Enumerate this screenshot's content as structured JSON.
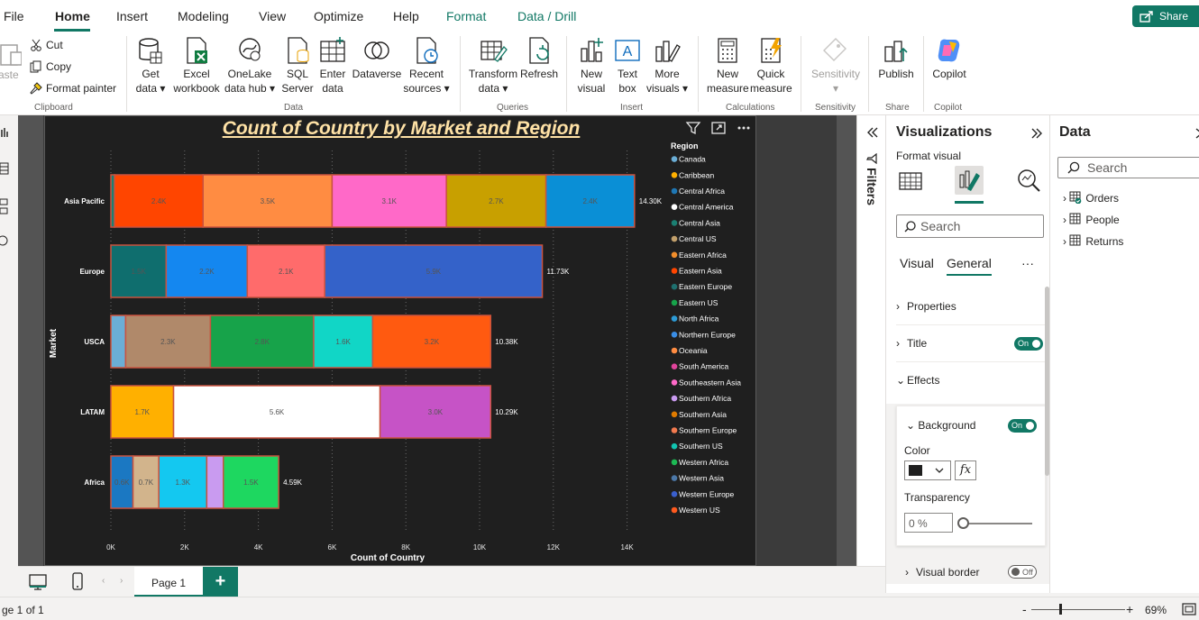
{
  "menu": {
    "tabs": [
      {
        "label": "File"
      },
      {
        "label": "Home"
      },
      {
        "label": "Insert"
      },
      {
        "label": "Modeling"
      },
      {
        "label": "View"
      },
      {
        "label": "Optimize"
      },
      {
        "label": "Help"
      },
      {
        "label": "Format"
      },
      {
        "label": "Data / Drill"
      }
    ],
    "share_label": "Share"
  },
  "ribbon": {
    "clipboard": {
      "paste": "aste",
      "cut": "Cut",
      "copy": "Copy",
      "format_painter": "Format painter",
      "group": "Clipboard"
    },
    "data": {
      "get_data": "Get\ndata ▾",
      "excel": "Excel\nworkbook",
      "onelake": "OneLake\ndata hub ▾",
      "sql": "SQL\nServer",
      "enter": "Enter\ndata",
      "dataverse": "Dataverse",
      "recent": "Recent\nsources ▾",
      "group": "Data"
    },
    "queries": {
      "transform": "Transform\ndata ▾",
      "refresh": "Refresh",
      "group": "Queries"
    },
    "insert": {
      "new_visual": "New\nvisual",
      "text_box": "Text\nbox",
      "more_visuals": "More\nvisuals ▾",
      "group": "Insert"
    },
    "calculations": {
      "new_measure": "New\nmeasure",
      "quick_measure": "Quick\nmeasure",
      "group": "Calculations"
    },
    "sensitivity": {
      "label": "Sensitivity\n▾",
      "group": "Sensitivity"
    },
    "share": {
      "publish": "Publish",
      "group": "Share"
    },
    "copilot": {
      "label": "Copilot",
      "group": "Copilot"
    }
  },
  "chart_data": {
    "type": "bar",
    "orientation": "horizontal",
    "stacked": true,
    "title": "Count of Country by Market and Region",
    "xlabel": "Count of Country",
    "ylabel": "Market",
    "xlim": [
      0,
      15000
    ],
    "x_ticks": [
      "0K",
      "2K",
      "4K",
      "6K",
      "8K",
      "10K",
      "12K",
      "14K"
    ],
    "categories": [
      "Asia Pacific",
      "Europe",
      "USCA",
      "LATAM",
      "Africa"
    ],
    "totals": [
      "14.30K",
      "11.73K",
      "10.38K",
      "10.29K",
      "4.59K"
    ],
    "legend_title": "Region",
    "legend_position": "right",
    "legend": [
      {
        "name": "Canada",
        "color": "#6baed6"
      },
      {
        "name": "Caribbean",
        "color": "#ffb000"
      },
      {
        "name": "Central Africa",
        "color": "#1f77b4"
      },
      {
        "name": "Central America",
        "color": "#ffffff"
      },
      {
        "name": "Central Asia",
        "color": "#1b7f72"
      },
      {
        "name": "Central US",
        "color": "#c2a06c"
      },
      {
        "name": "Eastern Africa",
        "color": "#f28e2b"
      },
      {
        "name": "Eastern Asia",
        "color": "#ff4500"
      },
      {
        "name": "Eastern Europe",
        "color": "#1e6f6e"
      },
      {
        "name": "Eastern US",
        "color": "#17a34a"
      },
      {
        "name": "North Africa",
        "color": "#2d9bd6"
      },
      {
        "name": "Northern Europe",
        "color": "#3a8ee6"
      },
      {
        "name": "Oceania",
        "color": "#ff8c42"
      },
      {
        "name": "South America",
        "color": "#e0449b"
      },
      {
        "name": "Southeastern Asia",
        "color": "#ff69c8"
      },
      {
        "name": "Southern Africa",
        "color": "#c99bf0"
      },
      {
        "name": "Southern Asia",
        "color": "#e07b00"
      },
      {
        "name": "Southern Europe",
        "color": "#f27a4f"
      },
      {
        "name": "Southern US",
        "color": "#11c4b0"
      },
      {
        "name": "Western Africa",
        "color": "#1db954"
      },
      {
        "name": "Western Asia",
        "color": "#4c78a8"
      },
      {
        "name": "Western Europe",
        "color": "#3a5fcd"
      },
      {
        "name": "Western US",
        "color": "#ff5a1f"
      }
    ],
    "series": [
      {
        "category": "Asia Pacific",
        "segments": [
          {
            "value": 100,
            "color": "#1b7f72",
            "label": ""
          },
          {
            "value": 2400,
            "color": "#ff4500",
            "label": "2.4K"
          },
          {
            "value": 3500,
            "color": "#ff8c42",
            "label": "3.5K"
          },
          {
            "value": 3100,
            "color": "#ff69c8",
            "label": "3.1K"
          },
          {
            "value": 2700,
            "color": "#c8a000",
            "label": "2.7K"
          },
          {
            "value": 2400,
            "color": "#0a8fd6",
            "label": "2.4K"
          }
        ]
      },
      {
        "category": "Europe",
        "segments": [
          {
            "value": 1500,
            "color": "#0f6e6e",
            "label": "1.5K"
          },
          {
            "value": 2200,
            "color": "#1487f0",
            "label": "2.2K"
          },
          {
            "value": 2100,
            "color": "#ff6b6b",
            "label": "2.1K"
          },
          {
            "value": 5900,
            "color": "#3462c9",
            "label": "5.9K"
          }
        ]
      },
      {
        "category": "USCA",
        "segments": [
          {
            "value": 400,
            "color": "#6baed6",
            "label": ""
          },
          {
            "value": 2300,
            "color": "#b0896a",
            "label": "2.3K"
          },
          {
            "value": 2800,
            "color": "#17a34a",
            "label": "2.8K"
          },
          {
            "value": 1600,
            "color": "#11d6c6",
            "label": "1.6K"
          },
          {
            "value": 3200,
            "color": "#ff5a10",
            "label": "3.2K"
          }
        ]
      },
      {
        "category": "LATAM",
        "segments": [
          {
            "value": 1700,
            "color": "#ffb000",
            "label": "1.7K"
          },
          {
            "value": 5600,
            "color": "#ffffff",
            "label": "5.6K"
          },
          {
            "value": 3000,
            "color": "#c653c6",
            "label": "3.0K"
          }
        ]
      },
      {
        "category": "Africa",
        "segments": [
          {
            "value": 600,
            "color": "#1b78c2",
            "label": "0.6K"
          },
          {
            "value": 700,
            "color": "#d2b48c",
            "label": "0.7K"
          },
          {
            "value": 1300,
            "color": "#14c8f0",
            "label": "1.3K"
          },
          {
            "value": 450,
            "color": "#c99bf0",
            "label": ""
          },
          {
            "value": 1500,
            "color": "#1ed760",
            "label": "1.5K"
          }
        ]
      }
    ]
  },
  "filters": {
    "label": "Filters"
  },
  "viz_pane": {
    "title": "Visualizations",
    "format_visual": "Format visual",
    "search_placeholder": "Search",
    "tabs": [
      "Visual",
      "General"
    ],
    "more": "···",
    "sections": {
      "properties": "Properties",
      "title": "Title",
      "title_toggle": "On",
      "effects": "Effects",
      "background": "Background",
      "background_toggle": "On",
      "color_label": "Color",
      "color_value": "#1f1f1f",
      "fx": "fx",
      "transparency_label": "Transparency",
      "transparency_value": "0 %",
      "visual_border": "Visual border",
      "visual_border_toggle": "Off"
    }
  },
  "data_pane": {
    "title": "Data",
    "search_placeholder": "Search",
    "tables": [
      "Orders",
      "People",
      "Returns"
    ]
  },
  "pages": {
    "tabs": [
      "Page 1"
    ],
    "add": "+"
  },
  "status": {
    "page": "ge 1 of 1",
    "zoom": "69%",
    "minus": "-",
    "plus": "+"
  }
}
